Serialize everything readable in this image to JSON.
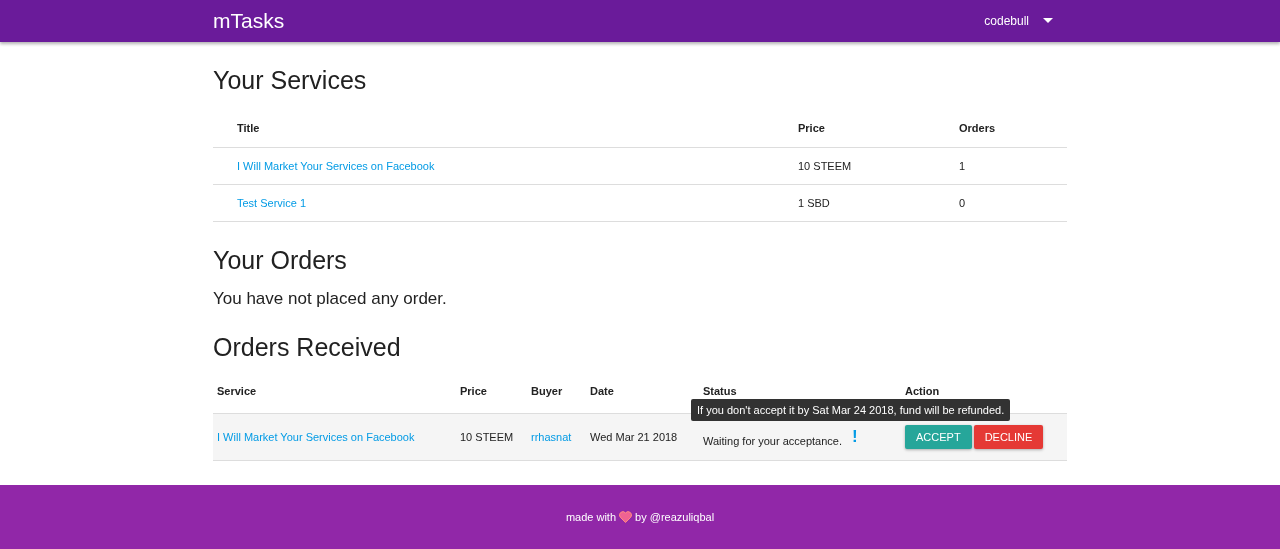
{
  "navbar": {
    "brand": "mTasks",
    "user": "codebull"
  },
  "services": {
    "title": "Your Services",
    "columns": [
      "Title",
      "Price",
      "Orders"
    ],
    "rows": [
      {
        "title": "I Will Market Your Services on Facebook",
        "price": "10 STEEM",
        "orders": "1"
      },
      {
        "title": "Test Service 1",
        "price": "1 SBD",
        "orders": "0"
      }
    ]
  },
  "orders": {
    "title": "Your Orders",
    "message": "You have not placed any order."
  },
  "received": {
    "title": "Orders Received",
    "columns": [
      "Service",
      "Price",
      "Buyer",
      "Date",
      "Status",
      "Action"
    ],
    "rows": [
      {
        "service": "I Will Market Your Services on Facebook",
        "price": "10 STEEM",
        "buyer": "rrhasnat",
        "date": "Wed Mar 21 2018",
        "status": "Waiting for your acceptance.",
        "alert": "!",
        "tooltip": "If you don't accept it by Sat Mar 24 2018, fund will be refunded.",
        "actions": [
          {
            "label": "ACCEPT",
            "kind": "accept"
          },
          {
            "label": "DECLINE",
            "kind": "decline"
          }
        ]
      }
    ]
  },
  "footer": {
    "text_before": "made with",
    "text_after": "by @reazuliqbal"
  }
}
